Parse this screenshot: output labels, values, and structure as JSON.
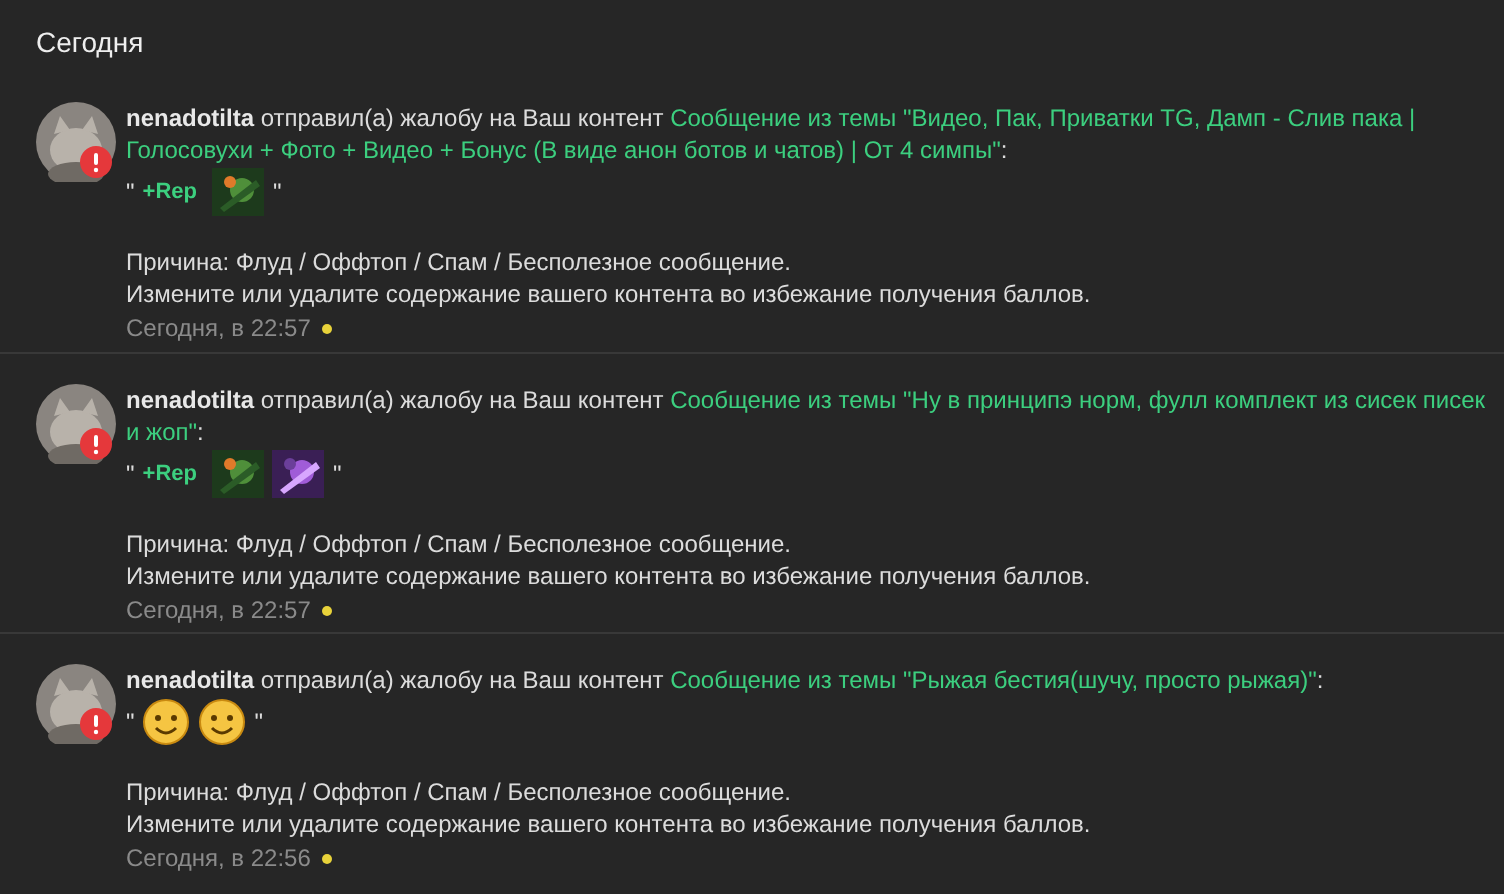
{
  "section_title": "Сегодня",
  "notifications": [
    {
      "user": "nenadotilta",
      "action": "отправил(а) жалобу на Ваш контент",
      "link": "Сообщение из темы \"Видео, Пак, Приватки TG, Дамп - Слив пака | Голосовухи + Фото + Видео + Бонус (В виде анон ботов и чатов) | От 4 симпы\"",
      "link_end": ":",
      "quote_open": "\"",
      "quote_parts": [
        {
          "kind": "rep",
          "text": "+Rep"
        },
        {
          "kind": "picture"
        }
      ],
      "quote_close": "\"",
      "reason": "Причина: Флуд / Оффтоп / Спам / Бесполезное сообщение.",
      "advice": "Измените или удалите содержание вашего контента во избежание получения баллов.",
      "time": "Сегодня, в 22:57"
    },
    {
      "user": "nenadotilta",
      "action": "отправил(а) жалобу на Ваш контент",
      "link": "Сообщение из темы \"Ну в принципэ норм, фулл комплект из сисек писек и жоп\"",
      "link_end": ":",
      "quote_open": "\"",
      "quote_parts": [
        {
          "kind": "rep",
          "text": "+Rep"
        },
        {
          "kind": "picture"
        },
        {
          "kind": "picture"
        }
      ],
      "quote_close": "\"",
      "reason": "Причина: Флуд / Оффтоп / Спам / Бесполезное сообщение.",
      "advice": "Измените или удалите содержание вашего контента во избежание получения баллов.",
      "time": "Сегодня, в 22:57"
    },
    {
      "user": "nenadotilta",
      "action": "отправил(а) жалобу на Ваш контент",
      "link": "Сообщение из темы \"Рыжая бестия(шучу, просто рыжая)\"",
      "link_end": ":",
      "quote_open": "\"",
      "quote_parts": [
        {
          "kind": "smiley"
        },
        {
          "kind": "smiley"
        }
      ],
      "quote_close": "\"",
      "reason": "Причина: Флуд / Оффтоп / Спам / Бесполезное сообщение.",
      "advice": "Измените или удалите содержание вашего контента во избежание получения баллов.",
      "time": "Сегодня, в 22:56"
    }
  ]
}
